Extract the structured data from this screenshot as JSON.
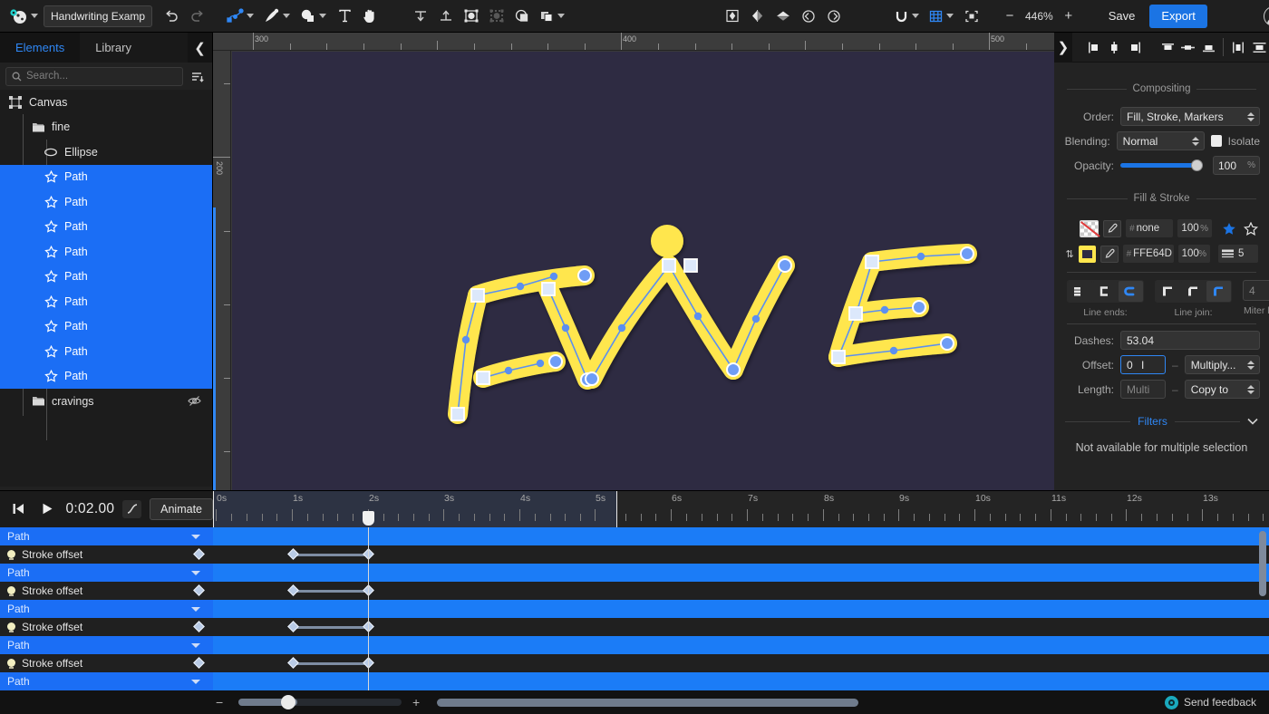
{
  "app": {
    "document_title": "Handwriting Example",
    "zoom_level": "446%",
    "save_label": "Save",
    "export_label": "Export",
    "accent_color": "#1b74e4",
    "canvas_bg": "#2e2b42",
    "artwork_color": "#FFE64D"
  },
  "toolbar": {
    "logo_icon": "app-logo-icon",
    "undo_icon": "undo-icon",
    "redo_icon": "redo-icon",
    "tools": [
      {
        "name": "node-tool",
        "icon": "node-editor-icon",
        "has_caret": true,
        "active": true
      },
      {
        "name": "pen-tool",
        "icon": "pen-icon",
        "has_caret": true,
        "active": false
      },
      {
        "name": "shape-tool",
        "icon": "shapes-icon",
        "has_caret": true,
        "active": false
      },
      {
        "name": "text-tool",
        "icon": "text-T-icon",
        "has_caret": false,
        "active": false
      },
      {
        "name": "hand-tool",
        "icon": "hand-icon",
        "has_caret": false,
        "active": false
      }
    ],
    "arrange": [
      {
        "name": "lower-to-bottom",
        "icon": "lower-to-bottom-icon"
      },
      {
        "name": "raise-to-top",
        "icon": "raise-to-top-icon"
      },
      {
        "name": "group",
        "icon": "group-icon"
      },
      {
        "name": "ungroup",
        "icon": "ungroup-icon"
      },
      {
        "name": "mask",
        "icon": "mask-icon"
      },
      {
        "name": "boolean-ops",
        "icon": "boolean-ops-icon",
        "has_caret": true
      }
    ],
    "transform": [
      {
        "name": "center-point",
        "icon": "transform-origin-icon"
      },
      {
        "name": "flip-horizontal",
        "icon": "flip-horizontal-icon"
      },
      {
        "name": "flip-vertical",
        "icon": "flip-vertical-icon"
      },
      {
        "name": "rotate-ccw",
        "icon": "rotate-counterclockwise-icon"
      },
      {
        "name": "rotate-cw",
        "icon": "rotate-clockwise-icon"
      }
    ],
    "snap": [
      {
        "name": "magnet-snap",
        "icon": "magnet-icon",
        "has_caret": true,
        "active": false
      },
      {
        "name": "grid-toggle",
        "icon": "grid-icon",
        "has_caret": true,
        "active": true
      },
      {
        "name": "fit-view",
        "icon": "fit-to-view-icon",
        "has_caret": false,
        "active": false
      }
    ],
    "zoom_minus": "−",
    "zoom_plus": "+",
    "account_icon": "user-avatar-icon"
  },
  "left_panel": {
    "tabs": [
      {
        "label": "Elements",
        "active": true
      },
      {
        "label": "Library",
        "active": false
      }
    ],
    "collapse_icon": "chevron-left-icon",
    "search": {
      "placeholder": "Search...",
      "value": "",
      "icon": "search-icon"
    },
    "sort_icon": "sort-list-icon",
    "tree": [
      {
        "label": "Canvas",
        "icon": "canvas-icon",
        "depth": 0,
        "selected": false,
        "hidden": false
      },
      {
        "label": "fine",
        "icon": "folder-icon",
        "depth": 1,
        "selected": false,
        "hidden": false
      },
      {
        "label": "Ellipse",
        "icon": "ellipse-icon",
        "depth": 2,
        "selected": false,
        "hidden": false
      },
      {
        "label": "Path",
        "icon": "path-star-icon",
        "depth": 2,
        "selected": true,
        "hidden": false
      },
      {
        "label": "Path",
        "icon": "path-star-icon",
        "depth": 2,
        "selected": true,
        "hidden": false
      },
      {
        "label": "Path",
        "icon": "path-star-icon",
        "depth": 2,
        "selected": true,
        "hidden": false
      },
      {
        "label": "Path",
        "icon": "path-star-icon",
        "depth": 2,
        "selected": true,
        "hidden": false
      },
      {
        "label": "Path",
        "icon": "path-star-icon",
        "depth": 2,
        "selected": true,
        "hidden": false
      },
      {
        "label": "Path",
        "icon": "path-star-icon",
        "depth": 2,
        "selected": true,
        "hidden": false
      },
      {
        "label": "Path",
        "icon": "path-star-icon",
        "depth": 2,
        "selected": true,
        "hidden": false
      },
      {
        "label": "Path",
        "icon": "path-star-icon",
        "depth": 2,
        "selected": true,
        "hidden": false
      },
      {
        "label": "Path",
        "icon": "path-star-icon",
        "depth": 2,
        "selected": true,
        "hidden": false
      },
      {
        "label": "cravings",
        "icon": "folder-icon",
        "depth": 1,
        "selected": false,
        "hidden": true
      }
    ],
    "hidden_icon": "eye-off-icon"
  },
  "canvas": {
    "ruler_h_labels": [
      "300",
      "400",
      "500"
    ],
    "ruler_v_labels": [
      "200"
    ],
    "artwork_text": "FINE"
  },
  "right_panel": {
    "collapse_icon": "chevron-right-icon",
    "align_buttons": [
      {
        "name": "align-left",
        "icon": "align-left-icon"
      },
      {
        "name": "align-center-horizontal",
        "icon": "align-center-horizontal-icon"
      },
      {
        "name": "align-right",
        "icon": "align-right-icon"
      },
      {
        "name": "align-top",
        "icon": "align-top-icon"
      },
      {
        "name": "align-middle-vertical",
        "icon": "align-middle-vertical-icon"
      },
      {
        "name": "align-bottom",
        "icon": "align-bottom-icon"
      },
      {
        "name": "distribute-horizontal",
        "icon": "distribute-horizontal-icon"
      },
      {
        "name": "distribute-vertical",
        "icon": "distribute-vertical-icon"
      }
    ],
    "compositing": {
      "title": "Compositing",
      "order_label": "Order:",
      "order_value": "Fill, Stroke, Markers",
      "blending_label": "Blending:",
      "blending_value": "Normal",
      "isolate_label": "Isolate",
      "isolate_checked": false,
      "opacity_label": "Opacity:",
      "opacity_value": "100",
      "opacity_unit": "%"
    },
    "fill_stroke": {
      "title": "Fill & Stroke",
      "swap_icon": "swap-fill-stroke-icon",
      "fill": {
        "swatch": "none",
        "hash": "#",
        "value": "none",
        "alpha": "100",
        "alpha_unit": "%",
        "eyedropper_icon": "eyedropper-icon"
      },
      "stroke": {
        "swatch_color": "#FFE64D",
        "hash": "#",
        "value": "FFE64D",
        "alpha": "100",
        "alpha_unit": "%",
        "width": "5",
        "width_icon": "stroke-width-icon",
        "eyedropper_icon": "eyedropper-icon"
      },
      "marker_solid_icon": "star-filled-icon",
      "marker_outline_icon": "star-outline-icon",
      "line_ends_label": "Line ends:",
      "line_ends": [
        {
          "name": "cap-butt",
          "icon": "cap-butt-icon",
          "active": false
        },
        {
          "name": "cap-square",
          "icon": "cap-square-icon",
          "active": false
        },
        {
          "name": "cap-round",
          "icon": "cap-round-icon",
          "active": true
        }
      ],
      "line_join_label": "Line join:",
      "line_joins": [
        {
          "name": "join-miter",
          "icon": "join-miter-icon",
          "active": false
        },
        {
          "name": "join-bevel",
          "icon": "join-bevel-icon",
          "active": false
        },
        {
          "name": "join-round",
          "icon": "join-round-icon",
          "active": true
        }
      ],
      "miter_limit_label": "Miter limit",
      "miter_limit_value": "4",
      "dashes_label": "Dashes:",
      "dashes_value": "53.04",
      "offset_label": "Offset:",
      "offset_value": "0",
      "offset_focused": true,
      "multiply_value": "Multiply...",
      "length_label": "Length:",
      "length_value": "Multi",
      "copy_to_value": "Copy to"
    },
    "filters": {
      "title": "Filters",
      "collapse_icon": "chevron-down-icon",
      "message": "Not available for multiple selection"
    }
  },
  "timeline": {
    "jump_start_icon": "skip-to-start-icon",
    "play_icon": "play-icon",
    "timecode": "0:02.00",
    "easing_icon": "easing-curve-icon",
    "animate_label": "Animate",
    "ruler_labels": [
      "0s",
      "1s",
      "2s",
      "3s",
      "4s",
      "5s",
      "6s",
      "7s",
      "8s",
      "9s",
      "10s",
      "11s",
      "12s",
      "13s"
    ],
    "playhead_time": "2s",
    "range_end": "5.5s",
    "rows": [
      {
        "label": "Path",
        "type": "group",
        "caret_icon": "chevron-down-icon"
      },
      {
        "label": "Stroke offset",
        "type": "property",
        "bulb_icon": "lightbulb-icon",
        "keyframe_icon": "diamond-keyframe-icon",
        "kf_start": "1s",
        "kf_end": "2s"
      },
      {
        "label": "Path",
        "type": "group",
        "caret_icon": "chevron-down-icon"
      },
      {
        "label": "Stroke offset",
        "type": "property",
        "bulb_icon": "lightbulb-icon",
        "keyframe_icon": "diamond-keyframe-icon",
        "kf_start": "1s",
        "kf_end": "2s"
      },
      {
        "label": "Path",
        "type": "group",
        "caret_icon": "chevron-down-icon"
      },
      {
        "label": "Stroke offset",
        "type": "property",
        "bulb_icon": "lightbulb-icon",
        "keyframe_icon": "diamond-keyframe-icon",
        "kf_start": "1s",
        "kf_end": "2s"
      },
      {
        "label": "Path",
        "type": "group",
        "caret_icon": "chevron-down-icon"
      },
      {
        "label": "Stroke offset",
        "type": "property",
        "bulb_icon": "lightbulb-icon",
        "keyframe_icon": "diamond-keyframe-icon",
        "kf_start": "1s",
        "kf_end": "2s"
      },
      {
        "label": "Path",
        "type": "group",
        "caret_icon": "chevron-down-icon"
      }
    ],
    "zoom_out_label": "−",
    "zoom_in_label": "+",
    "feedback_label": "Send feedback",
    "feedback_icon": "feedback-chat-icon"
  }
}
